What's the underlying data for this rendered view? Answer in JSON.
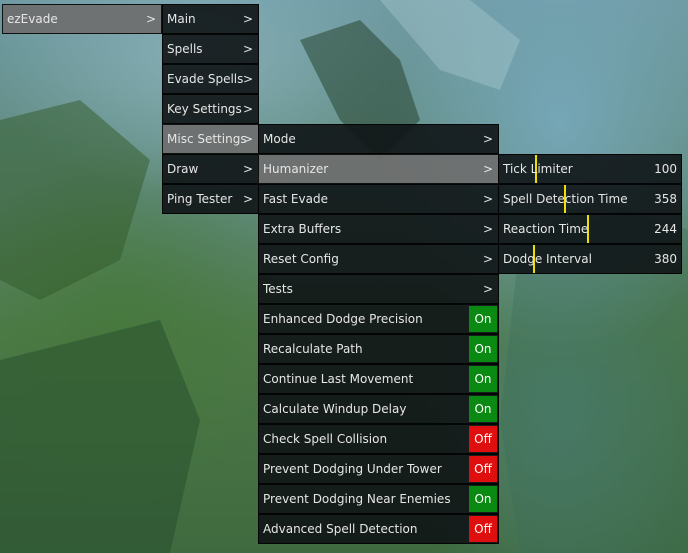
{
  "root": {
    "label": "ezEvade",
    "arrow": ">"
  },
  "main_menu": [
    {
      "label": "Main",
      "arrow": ">"
    },
    {
      "label": "Spells",
      "arrow": ">"
    },
    {
      "label": "Evade Spells",
      "arrow": ">"
    },
    {
      "label": "Key Settings",
      "arrow": ">"
    },
    {
      "label": "Misc Settings",
      "arrow": ">"
    },
    {
      "label": "Draw",
      "arrow": ">"
    },
    {
      "label": "Ping Tester",
      "arrow": ">"
    }
  ],
  "misc_menu": {
    "submenus": [
      {
        "label": "Mode",
        "arrow": ">"
      },
      {
        "label": "Humanizer",
        "arrow": ">"
      },
      {
        "label": "Fast Evade",
        "arrow": ">"
      },
      {
        "label": "Extra Buffers",
        "arrow": ">"
      },
      {
        "label": "Reset Config",
        "arrow": ">"
      },
      {
        "label": "Tests",
        "arrow": ">"
      }
    ],
    "toggles": [
      {
        "label": "Enhanced Dodge Precision",
        "state": "On"
      },
      {
        "label": "Recalculate Path",
        "state": "On"
      },
      {
        "label": "Continue Last Movement",
        "state": "On"
      },
      {
        "label": "Calculate Windup Delay",
        "state": "On"
      },
      {
        "label": "Check Spell Collision",
        "state": "Off"
      },
      {
        "label": "Prevent Dodging Under Tower",
        "state": "Off"
      },
      {
        "label": "Prevent Dodging Near Enemies",
        "state": "On"
      },
      {
        "label": "Advanced Spell Detection",
        "state": "Off"
      }
    ]
  },
  "humanizer_menu": [
    {
      "label": "Tick Limiter",
      "value": "100",
      "fraction": 0.2
    },
    {
      "label": "Spell Detection Time",
      "value": "358",
      "fraction": 0.36
    },
    {
      "label": "Reaction Time",
      "value": "244",
      "fraction": 0.49
    },
    {
      "label": "Dodge Interval",
      "value": "380",
      "fraction": 0.19
    }
  ],
  "colors": {
    "on": "#0a8a12",
    "off": "#e00f0f",
    "slider": "#f0e000",
    "active": "#6e6e6e"
  },
  "active_path": [
    "Misc Settings",
    "Humanizer"
  ]
}
